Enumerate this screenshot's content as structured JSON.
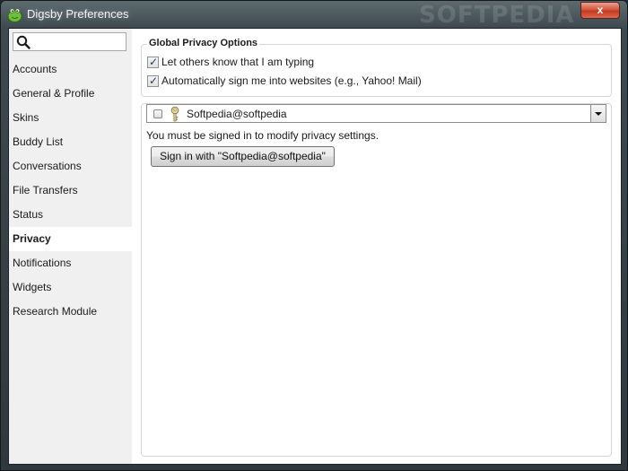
{
  "window": {
    "title": "Digsby Preferences",
    "watermark": "SOFTPEDIA",
    "close_label": "x"
  },
  "search": {
    "value": "",
    "placeholder": ""
  },
  "sidebar": {
    "items": [
      {
        "label": "Accounts"
      },
      {
        "label": "General & Profile"
      },
      {
        "label": "Skins"
      },
      {
        "label": "Buddy List"
      },
      {
        "label": "Conversations"
      },
      {
        "label": "File Transfers"
      },
      {
        "label": "Status"
      },
      {
        "label": "Privacy",
        "active": true
      },
      {
        "label": "Notifications"
      },
      {
        "label": "Widgets"
      },
      {
        "label": "Research Module"
      }
    ]
  },
  "privacy": {
    "group_title": "Global Privacy Options",
    "options": [
      {
        "label": "Let others know that I am typing",
        "checked": true
      },
      {
        "label": "Automatically sign me into websites (e.g., Yahoo! Mail)",
        "checked": true
      }
    ],
    "account": {
      "name": "Softpedia@softpedia",
      "checked": false
    },
    "message": "You must be signed in to modify privacy settings.",
    "signin_label": "Sign in with \"Softpedia@softpedia\""
  },
  "colors": {
    "sidebar_bg": "#f0f0f0",
    "active_item_bg": "#ffffff",
    "titlebar": "#3f4a50",
    "close_button": "#c23a20"
  }
}
